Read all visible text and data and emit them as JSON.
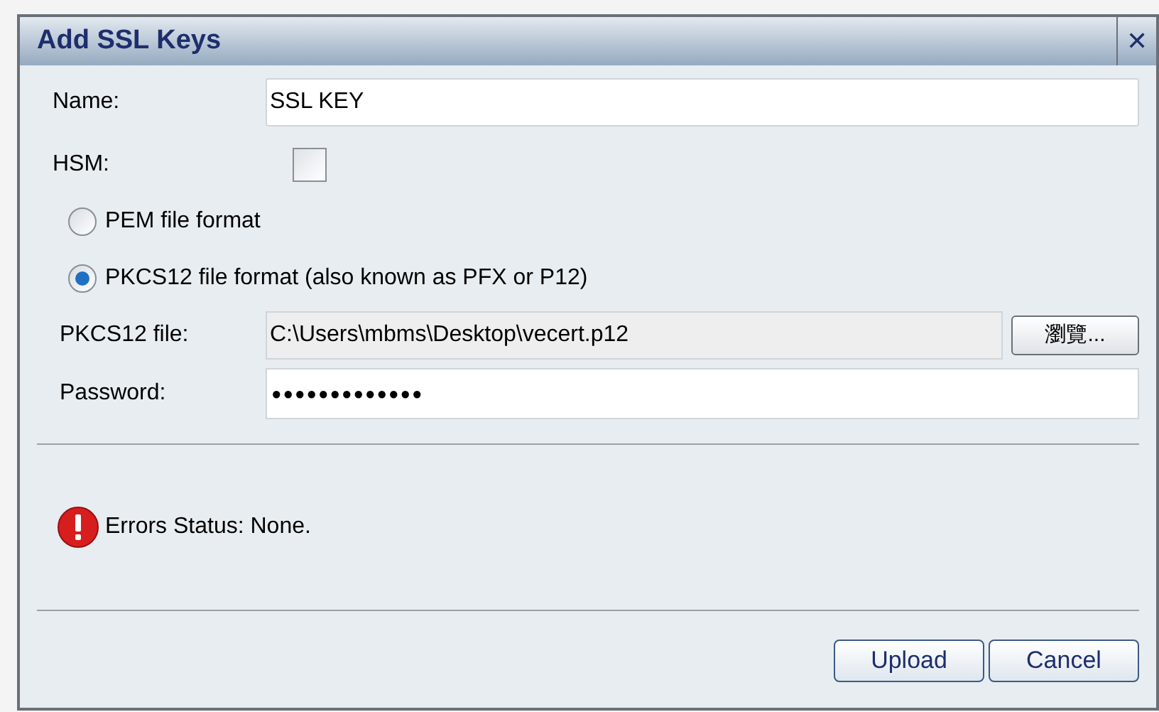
{
  "dialog": {
    "title": "Add SSL Keys",
    "close": "✕"
  },
  "name": {
    "label": "Name:",
    "value": "SSL KEY"
  },
  "hsm": {
    "label": "HSM:",
    "checked": false
  },
  "formats": [
    {
      "label": "PEM file format",
      "selected": false
    },
    {
      "label": "PKCS12 file format (also known as PFX or P12)",
      "selected": true
    }
  ],
  "file": {
    "label": "PKCS12 file:",
    "value": "C:\\Users\\mbms\\Desktop\\vecert.p12",
    "browse": "瀏覽..."
  },
  "password": {
    "label": "Password:",
    "value": "●●●●●●●●●●●●●"
  },
  "status": {
    "text": "Errors Status: None.",
    "error": true
  },
  "buttons": [
    "Upload",
    "Cancel"
  ]
}
